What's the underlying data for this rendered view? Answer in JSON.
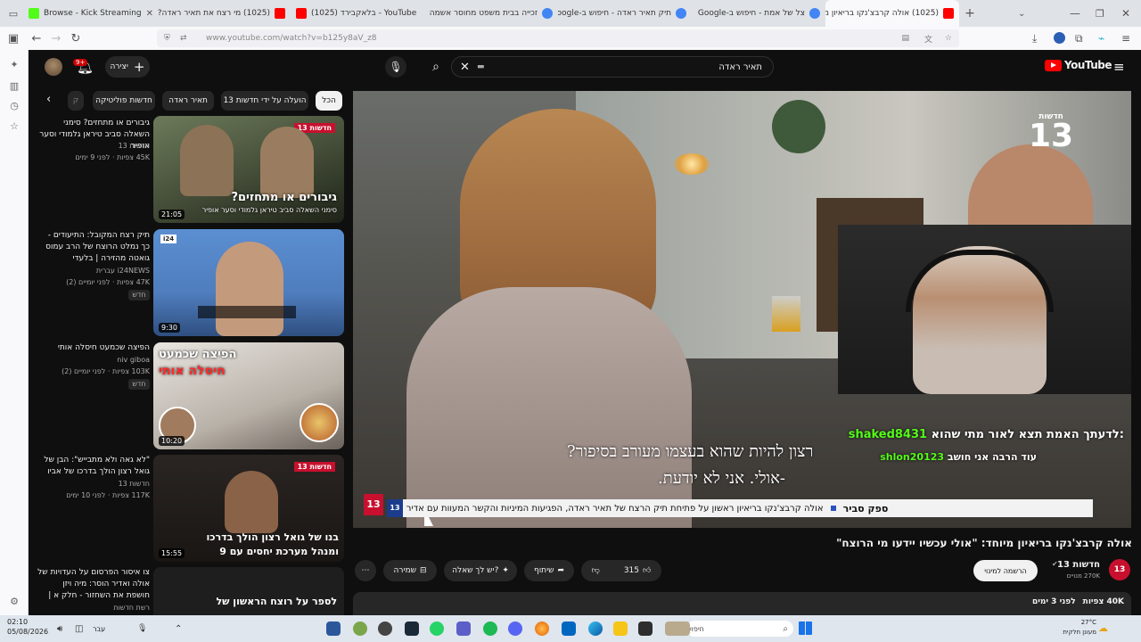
{
  "browser": {
    "tabs": [
      {
        "label": "Browse - Kick Streaming",
        "color": "#53fc18"
      },
      {
        "label": "(1025) מי רצח את תאיר ראדה?",
        "color": "#ff0000"
      },
      {
        "label": "(1025) בלאקבירד - YouTube",
        "color": "#ff0000"
      },
      {
        "label": "זכייה בבית משפט מחוסר אשמה",
        "color": "#4285f4"
      },
      {
        "label": "תיק תאיר ראדה - חיפוש ב-Google",
        "color": "#4285f4"
      },
      {
        "label": "צל של אמת - חיפוש ב-Google",
        "color": "#4285f4"
      },
      {
        "label": "(1025) אולה קרבצ'נקו בריאיון מ",
        "color": "#ff0000"
      }
    ],
    "url": "www.youtube.com/watch?v=b125y8aV_z8"
  },
  "youtube": {
    "search_value": "תאיר ראדה",
    "create_label": "יצירה",
    "notif_count": "9+",
    "logo_text": "YouTube",
    "chips": [
      "הכל",
      "הועלה על ידי חדשות 13",
      "תאיר ראדה",
      "חדשות פוליטיקה",
      "ק"
    ],
    "recs": [
      {
        "title": "גיבורים או מתחזים? סימני השאלה סביב טיראן גלמודי וסער אופיר",
        "channel": "חדשות 13",
        "meta": "45K צפיות · לפני 9 ימים",
        "duration": "21:05",
        "thumb_text": "גיבורים או מתחזים?",
        "thumb_sub": "סימני השאלה סביב טיראן גלמודי וסער אופיר"
      },
      {
        "title": "תיק רצח המקובל: התיעודים - כך נמלט הרוצח של הרב עמוס גואטה מהזירה | בלעדי",
        "channel": "i24NEWS עברית",
        "meta": "47K צפיות · לפני יומיים (2)",
        "badge": "חדש",
        "duration": "9:30",
        "thumb_text": "i24"
      },
      {
        "title": "הפיצה שכמעט חיסלה אותי",
        "channel": "niv giboa",
        "meta": "103K צפיות · לפני יומיים (2)",
        "badge": "חדש",
        "duration": "10:20",
        "thumb_text": "הפיצה שכמעט",
        "thumb_sub": "חיסלה אותי"
      },
      {
        "title": "\"לא גאה ולא מתבייש\": הבן של גואל רצון הולך בדרכו של אביו",
        "channel": "חדשות 13",
        "meta": "117K צפיות · לפני 10 ימים",
        "duration": "15:55",
        "thumb_text": "בנו של גואל רצון הולך בדרכו",
        "thumb_sub": "ומנהל מערכת יחסים עם 9"
      },
      {
        "title": "צו איסור הפרסום על העדויות של אולה ואדיר הוסר: מיה ויזן חושפת את השחזור - חלק א | לאולה אין...",
        "channel": "רשת חדשות",
        "meta": "",
        "duration": "",
        "thumb_text": "לספר על רוצח הראשון של"
      }
    ],
    "video": {
      "news_logo": "13",
      "news_logo_sub": "חדשות",
      "subtitle_line1": "?רצון להיות שהוא בעצמו מעורב בסיפור",
      "subtitle_line2": "-אולי. אני לא יודעת.",
      "ticker_label": "ספק סביר",
      "ticker_text": "אולה קרבצ'נקו בריאיון ראשון על פתיחת תיק הרצח של תאיר ראדה, הפגיעות המיניות והקשר המעוות עם אדיר חבני",
      "chat": [
        {
          "user": "shaked8431",
          "text": ":לדעתך האמת תצא לאור מתי שהוא"
        },
        {
          "user": "shlon20123",
          "text": "עוד הרבה אני חושב"
        }
      ],
      "title": "אולה קרבצ'נקו בריאיון מיוחד: \"אולי עכשיו יידעו מי הרוצח\""
    },
    "channel": {
      "name": "חדשות 13",
      "subs": "270K מנויים",
      "join": "הרשמה למינוי"
    },
    "actions": {
      "likes": "315",
      "share": "שיתוף",
      "ask": "יש לך שאלה?",
      "save": "שמירה"
    },
    "desc": {
      "views": "40K צפיות",
      "date": "לפני 3 ימים"
    }
  },
  "taskbar": {
    "time": "02:10",
    "date": "05/08/2026",
    "lang": "עבר",
    "search_placeholder": "חיפוש",
    "weather_temp": "27°C",
    "weather_desc": "מעונן חלקית"
  }
}
